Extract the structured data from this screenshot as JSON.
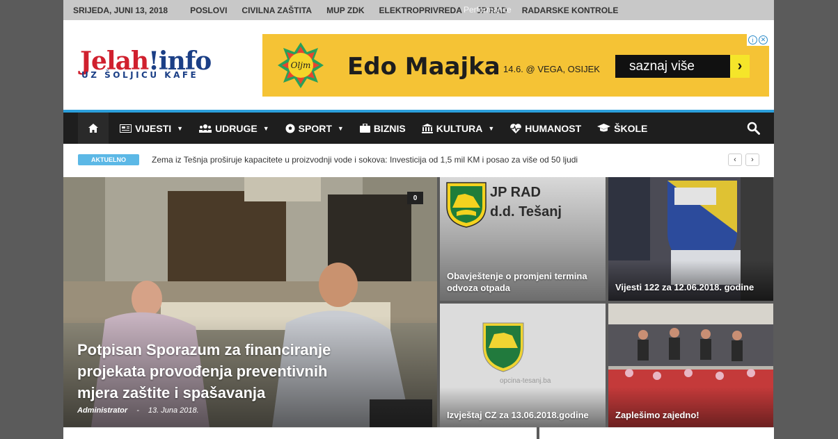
{
  "topbar": {
    "date": "SRIJEDA, JUNI 13, 2018",
    "links": [
      "POSLOVI",
      "CIVILNA ZAŠTITA",
      "MUP ZDK",
      "ELEKTROPRIVREDA",
      "JP RAD",
      "RADARSKE KONTROLE"
    ],
    "overlay_text": "Performance"
  },
  "logo": {
    "part1": "Jelah",
    "part2": "!info",
    "tagline": "UZ ŠOLJICU KAFE"
  },
  "ad": {
    "brand": "Oljm",
    "artist": "Edo Maajka",
    "event": "14.6. @ VEGA, OSIJEK",
    "cta": "saznaj više",
    "cta_arrow": "›",
    "adchoices_info": "i",
    "adchoices_close": "✕",
    "color": "#f5c335"
  },
  "nav": {
    "items": [
      {
        "label": "VIJESTI",
        "icon": "newspaper-icon",
        "dropdown": true
      },
      {
        "label": "UDRUGE",
        "icon": "users-icon",
        "dropdown": true
      },
      {
        "label": "SPORT",
        "icon": "soccer-ball-icon",
        "dropdown": true
      },
      {
        "label": "BIZNIS",
        "icon": "briefcase-icon",
        "dropdown": false
      },
      {
        "label": "KULTURA",
        "icon": "museum-icon",
        "dropdown": true
      },
      {
        "label": "HUMANOST",
        "icon": "heartbeat-icon",
        "dropdown": false
      },
      {
        "label": "ŠKOLE",
        "icon": "graduation-cap-icon",
        "dropdown": false
      }
    ],
    "chevron": "▼",
    "accent_color": "#2b9fdb"
  },
  "ticker": {
    "badge": "AKTUELNO",
    "headline": "Zema iz Tešnja proširuje kapacitete u proizvodnji vode i sokova: Investicija od 1,5 mil KM i posao za više od 50 ljudi",
    "prev": "‹",
    "next": "›"
  },
  "featured": {
    "title": "Potpisan Sporazum za financiranje projekata provođenja preventivnih mjera zaštite i spašavanja",
    "author": "Administrator",
    "separator": "-",
    "date": "13. Juna 2018.",
    "comments": "0"
  },
  "tiles": [
    {
      "title": "Obavještenje o promjeni termina odvoza otpada",
      "image_text_line1": "JP RAD",
      "image_text_line2": "d.d. Tešanj"
    },
    {
      "title": "Vijesti 122 za 12.06.2018. godine"
    },
    {
      "title": "Izvještaj CZ za 13.06.2018.godine",
      "watermark": "opcina-tesanj.ba"
    },
    {
      "title": "Zaplešimo zajedno!"
    }
  ]
}
